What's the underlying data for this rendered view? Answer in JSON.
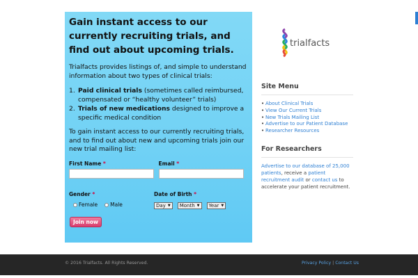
{
  "signup": {
    "headline": "Gain instant access to our currently recruiting trials, and find out about upcoming trials.",
    "intro": "Trialfacts provides listings of, and simple to understand information about two types of clinical trials:",
    "items": [
      {
        "num": "1.",
        "bold": "Paid clinical trials",
        "rest": " (sometimes called reimbursed, compensated or “healthy volunteer” trials)"
      },
      {
        "num": "2.",
        "bold": "Trials of new medications",
        "rest": " designed to improve a specific medical condition"
      }
    ],
    "cta": "To gain instant access to our currently recruiting trials, and to find out about new and upcoming trials join our new trial mailing list:",
    "form": {
      "first_name_label": "First Name",
      "email_label": "Email",
      "required_mark": "*",
      "first_name_value": "",
      "email_value": "",
      "gender_label": "Gender",
      "gender_options": [
        "Female",
        "Male"
      ],
      "dob_label": "Date of Birth",
      "day": "Day",
      "month": "Month",
      "year": "Year",
      "join_label": "Join now"
    }
  },
  "sidebar": {
    "logo_text": "trialfacts",
    "site_menu_title": "Site Menu",
    "site_menu": [
      "About Clinical Trials",
      "View Our Current Trials",
      "New Trials Mailing List",
      "Advertise to our Patient Database",
      "Researcher Resources"
    ],
    "researchers_title": "For Researchers",
    "researchers": {
      "link1": "Advertise to our database of 25,000 patients",
      "text1": ", receive a ",
      "link2": "patient recruitment audit",
      "text2": " or ",
      "link3": "contact us",
      "text3": " to accelerate your patient recruitment."
    }
  },
  "footer": {
    "copyright": "© 2016 Trialfacts. All Rights Reserved.",
    "privacy": "Privacy Policy",
    "separator": "|",
    "contact": "Contact Us"
  },
  "colors": {
    "panel": "#72d2f5",
    "link": "#2d7fd3",
    "button": "#d93d6d",
    "footer": "#262626"
  },
  "icons": {
    "logo": "trialfacts-ribbon-logo"
  }
}
